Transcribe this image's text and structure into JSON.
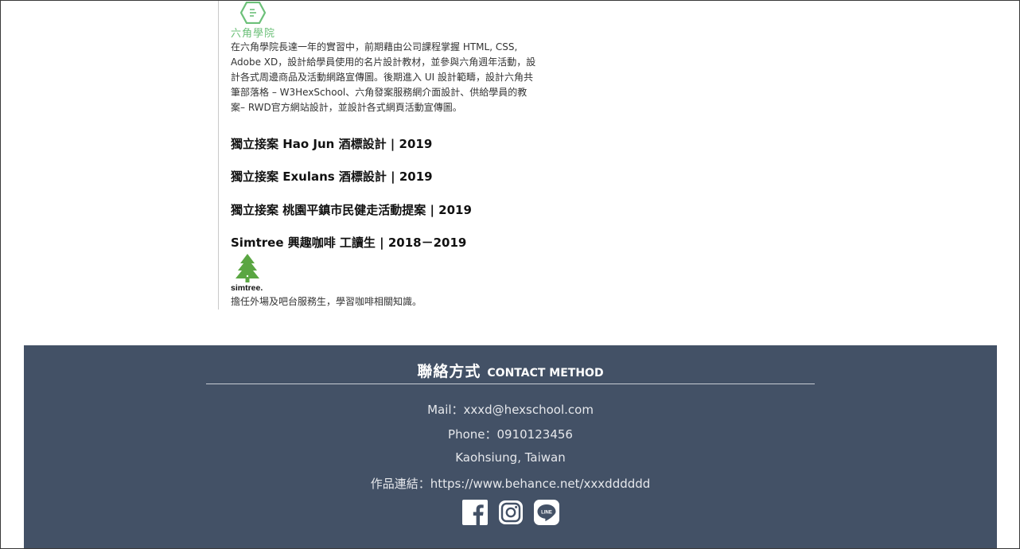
{
  "experience": {
    "hexschool": {
      "name": "六角學院",
      "description": "在六角學院長達一年的實習中，前期藉由公司課程掌握 HTML, CSS, Adobe XD，設計給學員使用的名片設計教材，並參與六角週年活動，設計各式周邊商品及活動網路宣傳圖。後期進入 UI 設計範疇，設計六角共筆部落格 – W3HexSchool、六角發案服務網介面設計、供給學員的教案– RWD官方網站設計，並設計各式網頁活動宣傳圖。",
      "description_lines": [
        "在六角學院長達一年的實習中，前期藉由公司課程掌握 HTML, CSS,",
        "Adobe XD，設計給學員使用的名片設計教材，並參與六角週年活動，設",
        "計各式周邊商品及活動網路宣傳圖。後期進入 UI 設計範疇，設計六角共",
        "筆部落格 – W3HexSchool、六角發案服務網介面設計、供給學員的教",
        "案– RWD官方網站設計，並設計各式網頁活動宣傳圖。"
      ],
      "logo_icon": "hexagon-logo-icon",
      "accent_color": "#6cc079"
    },
    "jobs": [
      "獨立接案 Hao Jun 酒標設計 | 2019",
      "獨立接案 Exulans 酒標設計 | 2019",
      "獨立接案 桃園平鎮市民健走活動提案 | 2019",
      "Simtree 興趣咖啡 工讀生 | 2018－2019"
    ],
    "simtree": {
      "logo_text": "simtree.",
      "logo_icon": "tree-logo-icon",
      "description": "擔任外場及吧台服務生，學習咖啡相關知識。",
      "accent_color": "#5aa642"
    }
  },
  "footer": {
    "heading_zh": "聯絡方式",
    "heading_en": "CONTACT METHOD",
    "mail": "Mail：xxxd@hexschool.com",
    "phone": "Phone：0910123456",
    "location": "Kaohsiung, Taiwan",
    "portfolio": "作品連結：https://www.behance.net/xxxdddddd",
    "social_icons": [
      "facebook-icon",
      "instagram-icon",
      "line-icon"
    ],
    "background_color": "#435166"
  }
}
